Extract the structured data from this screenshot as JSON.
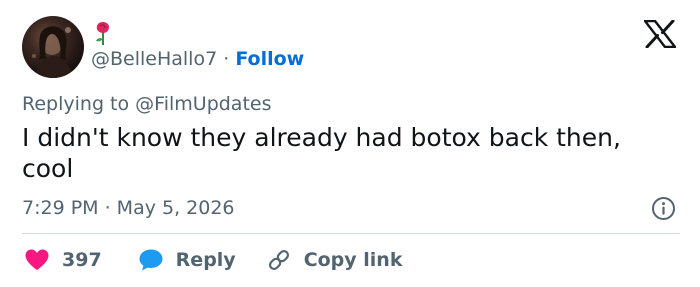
{
  "author": {
    "handle": "@BelleHallo7",
    "separator": "·",
    "follow_label": "Follow"
  },
  "icons": {
    "avatar": "user-avatar-photo",
    "emoji": "rose-emoji",
    "brand": "x-logo",
    "info": "info-icon",
    "like": "heart-icon",
    "reply": "speech-bubble-icon",
    "copy": "link-icon"
  },
  "reply_context": {
    "prefix": "Replying to",
    "mention": "@FilmUpdates"
  },
  "tweet": {
    "text": "I didn't know they already had botox back then, cool",
    "timestamp": "7:29 PM · May 5, 2026"
  },
  "actions": {
    "like_count": "397",
    "reply_label": "Reply",
    "copy_label": "Copy link"
  },
  "colors": {
    "heart": "#f91880",
    "reply_bubble": "#1d9bf0",
    "follow": "#006fd6",
    "secondary_text": "#536471",
    "primary_text": "#0f1419"
  }
}
